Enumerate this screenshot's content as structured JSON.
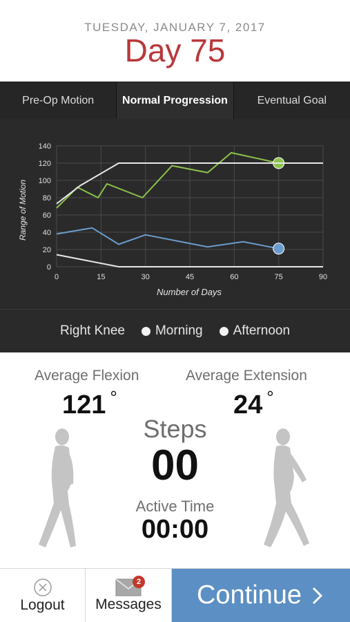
{
  "header": {
    "date": "TUESDAY, JANUARY 7, 2017",
    "day": "Day 75",
    "day_color": "#b8383a"
  },
  "tabs": [
    {
      "label": "Pre-Op Motion",
      "active": false
    },
    {
      "label": "Normal Progression",
      "active": true
    },
    {
      "label": "Eventual Goal",
      "active": false
    }
  ],
  "chart_data": {
    "type": "line",
    "xlabel": "Number of Days",
    "ylabel": "Range of Motion",
    "xlim": [
      0,
      90
    ],
    "ylim": [
      0,
      140
    ],
    "xticks": [
      0,
      15,
      30,
      45,
      60,
      75,
      90
    ],
    "yticks": [
      0,
      20,
      40,
      60,
      80,
      100,
      120,
      140
    ],
    "grid": true,
    "series": [
      {
        "color": "#8bc34a",
        "x": [
          0,
          7,
          14,
          17,
          29,
          39,
          51,
          59,
          75
        ],
        "y": [
          68,
          92,
          80,
          96,
          80,
          117,
          109,
          132,
          120
        ],
        "end_marker": true
      },
      {
        "color": "#6a9ccc",
        "x": [
          0,
          12,
          21,
          30,
          51,
          63,
          75
        ],
        "y": [
          38,
          45,
          26,
          37,
          23,
          29,
          21
        ],
        "end_marker": true
      },
      {
        "color": "#e8e8e8",
        "x": [
          0,
          8,
          21,
          90
        ],
        "y": [
          73,
          94,
          120,
          120
        ],
        "end_marker": false
      },
      {
        "color": "#e8e8e8",
        "x": [
          0,
          21,
          90
        ],
        "y": [
          14,
          0,
          0
        ],
        "end_marker": false
      }
    ]
  },
  "legend": {
    "knee": "Right Knee",
    "morning": "Morning",
    "afternoon": "Afternoon"
  },
  "stats": {
    "flexion_label": "Average Flexion",
    "flexion_value": "121",
    "extension_label": "Average Extension",
    "extension_value": "24",
    "degree_symbol": "°",
    "steps_label": "Steps",
    "steps_value": "00",
    "active_label": "Active Time",
    "active_value": "00:00"
  },
  "footer": {
    "logout_label": "Logout",
    "messages_label": "Messages",
    "messages_badge": "2",
    "continue_label": "Continue",
    "continue_color": "#5c8fc3"
  }
}
